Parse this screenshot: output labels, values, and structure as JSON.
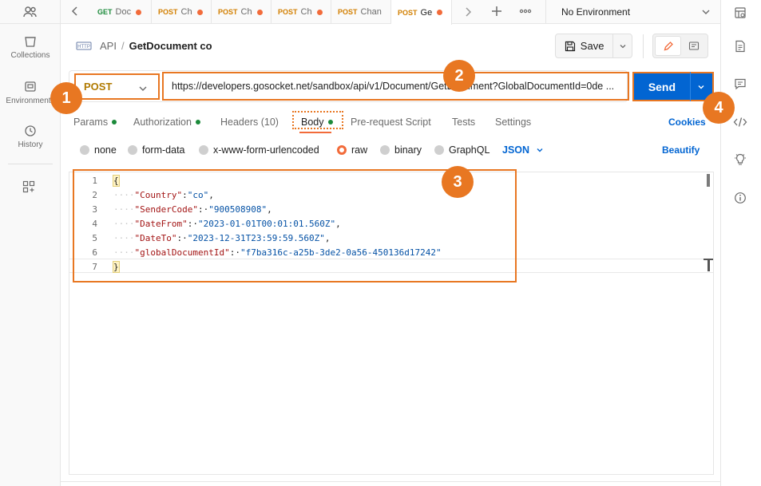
{
  "sidebar": {
    "items": [
      {
        "label": "Collections",
        "icon": "collections-icon"
      },
      {
        "label": "Environments",
        "icon": "environments-icon"
      },
      {
        "label": "History",
        "icon": "history-icon"
      }
    ]
  },
  "tabs": [
    {
      "method": "GET",
      "name": "Doc"
    },
    {
      "method": "POST",
      "name": "Ch"
    },
    {
      "method": "POST",
      "name": "Ch"
    },
    {
      "method": "POST",
      "name": "Ch"
    },
    {
      "method": "POST",
      "name": "Chan"
    },
    {
      "method": "POST",
      "name": "Ge"
    }
  ],
  "environment": "No Environment",
  "breadcrumb": {
    "parent": "API",
    "separator": "/",
    "current": "GetDocument co"
  },
  "save_label": "Save",
  "request": {
    "method": "POST",
    "url": "https://developers.gosocket.net/sandbox/api/v1/Document/GetDocument?GlobalDocumentId=0de ...",
    "send_label": "Send"
  },
  "subtabs": {
    "params": "Params",
    "authorization": "Authorization",
    "headers": "Headers (10)",
    "body": "Body",
    "prerequest": "Pre-request Script",
    "tests": "Tests",
    "settings": "Settings",
    "cookies": "Cookies"
  },
  "body_types": {
    "none": "none",
    "form_data": "form-data",
    "urlencoded": "x-www-form-urlencoded",
    "raw": "raw",
    "binary": "binary",
    "graphql": "GraphQL",
    "format": "JSON",
    "beautify": "Beautify"
  },
  "code": {
    "line_numbers": [
      "1",
      "2",
      "3",
      "4",
      "5",
      "6",
      "7"
    ],
    "open": "{",
    "close": "}",
    "l2k": "\"Country\"",
    "l2v": "\"co\"",
    "l3k": "\"SenderCode\"",
    "l3v": "\"900508908\"",
    "l4k": "\"DateFrom\"",
    "l4v": "\"2023-01-01T00:01:01.560Z\"",
    "l5k": "\"DateTo\"",
    "l5v": "\"2023-12-31T23:59:59.560Z\"",
    "l6k": "\"globalDocumentId\"",
    "l6v": "\"f7ba316c-a25b-3de2-0a56-450136d17242\""
  },
  "badges": [
    "1",
    "2",
    "3",
    "4"
  ],
  "colors": {
    "accent": "#e87722",
    "send": "#0265d2",
    "link": "#0265d2"
  }
}
